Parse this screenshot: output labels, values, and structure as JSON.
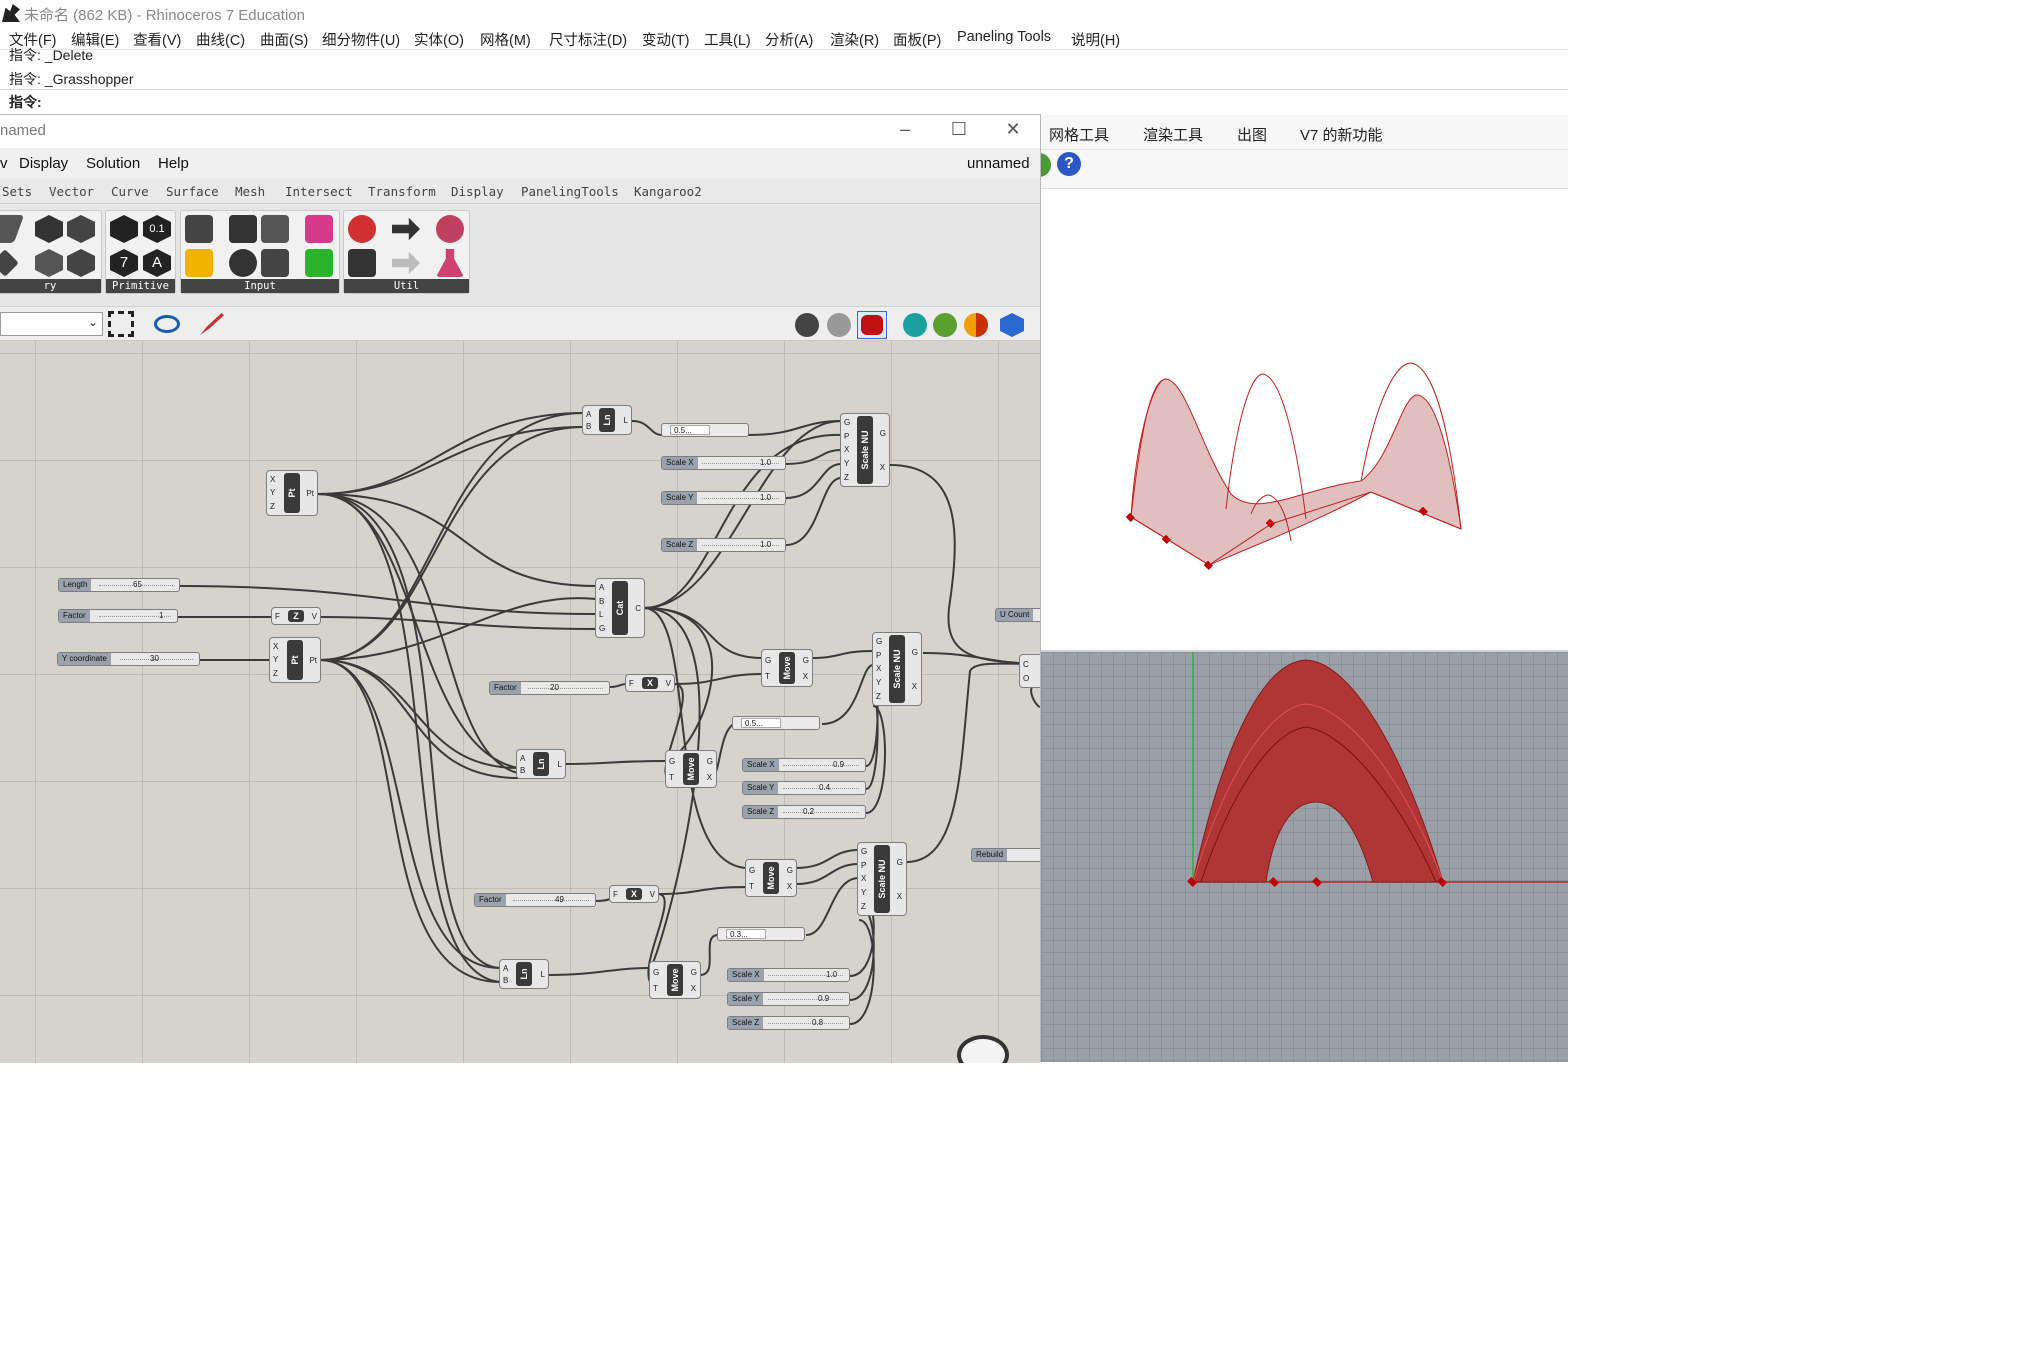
{
  "app": {
    "title": "未命名 (862 KB) - Rhinoceros 7 Education"
  },
  "menu": [
    "文件(F)",
    "编辑(E)",
    "查看(V)",
    "曲线(C)",
    "曲面(S)",
    "细分物件(U)",
    "实体(O)",
    "网格(M)",
    "尺寸标注(D)",
    "变动(T)",
    "工具(L)",
    "分析(A)",
    "渲染(R)",
    "面板(P)",
    "Paneling Tools",
    "说明(H)"
  ],
  "command": {
    "history": [
      "指令: _Delete",
      "指令: _Grasshopper"
    ],
    "prompt": "指令:"
  },
  "rhino_tabs": [
    "网格工具",
    "渲染工具",
    "出图",
    "V7 的新功能"
  ],
  "gh": {
    "title": "named",
    "doc_name": "unnamed",
    "menu": [
      "v",
      "Display",
      "Solution",
      "Help"
    ],
    "tabs": [
      "Sets",
      "Vector",
      "Curve",
      "Surface",
      "Mesh",
      "Intersect",
      "Transform",
      "Display",
      "PanelingTools",
      "Kangaroo2"
    ],
    "groups": [
      "ry",
      "Primitive",
      "Input",
      "Util"
    ],
    "primitive_labels": [
      "0.1",
      "7",
      "A"
    ]
  },
  "components": {
    "ln": "Ln",
    "pt": "Pt",
    "cat": "Cat",
    "z": "Z",
    "x": "X",
    "move": "Move",
    "scale_nu": "Scale NU",
    "ins_ab": [
      "A",
      "B"
    ],
    "out_l": "L",
    "ins_xyz": [
      "X",
      "Y",
      "Z"
    ],
    "out_pt": "Pt",
    "ins_cat": [
      "A",
      "B",
      "L",
      "G"
    ],
    "out_c": "C",
    "ins_f": [
      "F"
    ],
    "out_v": "V",
    "ins_gt": [
      "G",
      "T"
    ],
    "outs_gx": [
      "G",
      "X"
    ],
    "ins_scale": [
      "G",
      "P",
      "X",
      "Y",
      "Z"
    ],
    "ins_co": [
      "C",
      "O"
    ]
  },
  "sliders": {
    "length": {
      "label": "Length",
      "value": "65"
    },
    "factor1": {
      "label": "Factor",
      "value": "1"
    },
    "ycoord": {
      "label": "Y coordinate",
      "value": "30"
    },
    "factor20": {
      "label": "Factor",
      "value": "20"
    },
    "factor49": {
      "label": "Factor",
      "value": "49"
    },
    "s1x": {
      "label": "Scale X",
      "value": "1.0"
    },
    "s1y": {
      "label": "Scale Y",
      "value": "1.0"
    },
    "s1z": {
      "label": "Scale Z",
      "value": "1.0"
    },
    "s2x": {
      "label": "Scale X",
      "value": "0.9"
    },
    "s2y": {
      "label": "Scale Y",
      "value": "0.4"
    },
    "s2z": {
      "label": "Scale Z",
      "value": "0.2"
    },
    "s3x": {
      "label": "Scale X",
      "value": "1.0"
    },
    "s3y": {
      "label": "Scale Y",
      "value": "0.9"
    },
    "s3z": {
      "label": "Scale Z",
      "value": "0.8"
    },
    "ucount": {
      "label": "U Count",
      "value": ""
    },
    "rebuild": {
      "label": "Rebuild",
      "value": ""
    }
  },
  "panels": {
    "p1": "0.5...",
    "p2": "0.5...",
    "p3": "0.3..."
  },
  "colors": {
    "surface": "#c98a8a",
    "curve": "#c02020",
    "viewport_bg": "#99a0a8",
    "canvas": "#d6d3cc"
  }
}
